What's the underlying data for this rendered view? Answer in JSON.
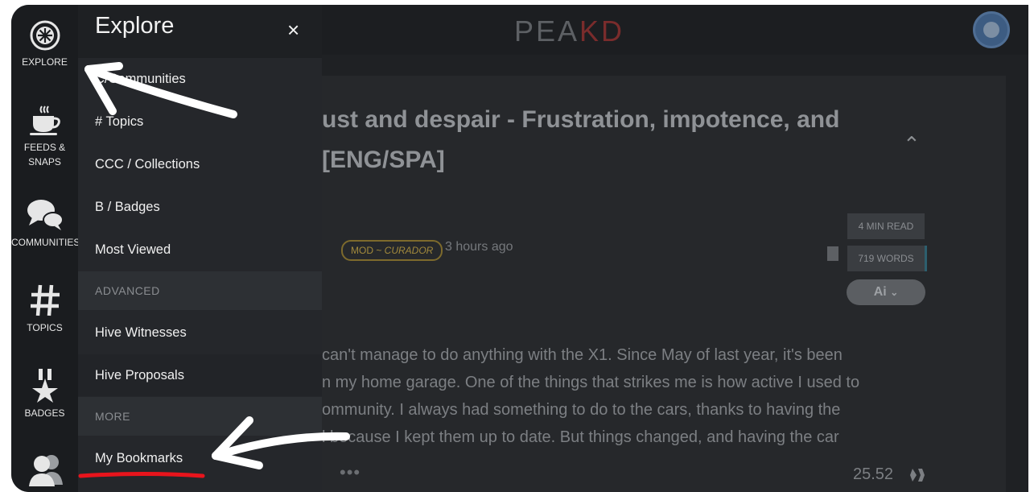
{
  "app": {
    "logo_text_a": "PEA",
    "logo_text_b": "KD"
  },
  "rail": {
    "items": [
      {
        "label": "EXPLORE",
        "icon": "compass-icon"
      },
      {
        "label_line1": "FEEDS &",
        "label_line2": "SNAPS",
        "icon": "coffee-cup-icon"
      },
      {
        "label": "COMMUNITIES",
        "icon": "speech-bubbles-icon"
      },
      {
        "label": "TOPICS",
        "icon": "hashtag-icon"
      },
      {
        "label": "BADGES",
        "icon": "medal-star-icon"
      },
      {
        "label": "",
        "icon": "users-icon"
      }
    ]
  },
  "explore": {
    "title": "Explore",
    "close_icon": "×",
    "items": [
      {
        "label": "C/Communities"
      },
      {
        "label": "# Topics"
      },
      {
        "label": "CCC / Collections"
      },
      {
        "label": "B / Badges"
      },
      {
        "label": "Most Viewed"
      }
    ],
    "section_advanced": "ADVANCED",
    "advanced_items": [
      {
        "label": "Hive Witnesses"
      },
      {
        "label": "Hive Proposals"
      }
    ],
    "section_more": "MORE",
    "more_items": [
      {
        "label": "My Bookmarks"
      }
    ]
  },
  "post": {
    "title_line1": "ust and despair - Frustration, impotence, and",
    "title_line2": "[ENG/SPA]",
    "mod_badge_a": "MOD ~ ",
    "mod_badge_b": "CURADOR",
    "time": "3 hours ago",
    "read_time": "4 MIN READ",
    "words": "719 WORDS",
    "ai_label": "Ai",
    "body": [
      "can't manage to do anything with the X1. Since May of last year, it's been",
      "n my home garage. One of the things that strikes me is how active I used to",
      "ommunity. I always had something to do to the cars, thanks to having the",
      "l because I kept them up to date. But things changed, and having the car"
    ],
    "dots": "•••",
    "payout": "25.52"
  },
  "colors": {
    "panel": "#25272b",
    "rail": "#1a1c1f",
    "accent_red": "#e8141c",
    "mod_gold": "#a38a3c"
  }
}
